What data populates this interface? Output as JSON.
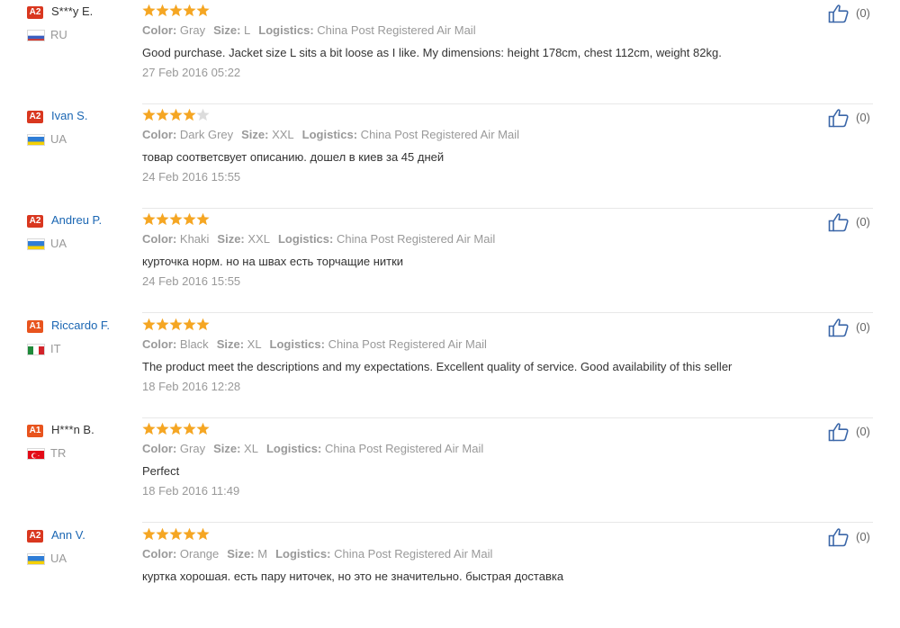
{
  "labels": {
    "color": "Color:",
    "size": "Size:",
    "logistics": "Logistics:"
  },
  "colors": {
    "star_on": "#f5a623",
    "star_off": "#dcdcdc",
    "name": "#333333",
    "link": "#1a66b3",
    "level_a2": "#d9371f",
    "level_a1": "#e8541e",
    "like_icon": "#3a66a8"
  },
  "reviews": [
    {
      "level": "A2",
      "name": "S***y E.",
      "country": "RU",
      "flag": "ru",
      "stars": 5,
      "color": "Gray",
      "size": "L",
      "logistics": "China Post Registered Air Mail",
      "text": "Good purchase. Jacket size L sits a bit loose as I like. My dimensions: height 178cm, chest 112cm, weight 82kg.",
      "date": "27 Feb 2016 05:22",
      "likes": "(0)"
    },
    {
      "level": "A2",
      "name": "Ivan S.",
      "country": "UA",
      "flag": "ua",
      "stars": 4,
      "color": "Dark Grey",
      "size": "XXL",
      "logistics": "China Post Registered Air Mail",
      "text": "товар соответсвует описанию. дошел в киев за 45 дней",
      "date": "24 Feb 2016 15:55",
      "likes": "(0)"
    },
    {
      "level": "A2",
      "name": "Andreu P.",
      "country": "UA",
      "flag": "ua",
      "stars": 5,
      "color": "Khaki",
      "size": "XXL",
      "logistics": "China Post Registered Air Mail",
      "text": "курточка норм. но на швах есть торчащие нитки",
      "date": "24 Feb 2016 15:55",
      "likes": "(0)"
    },
    {
      "level": "A1",
      "name": "Riccardo F.",
      "country": "IT",
      "flag": "it",
      "stars": 5,
      "color": "Black",
      "size": "XL",
      "logistics": "China Post Registered Air Mail",
      "text": "The product meet the descriptions and my expectations. Excellent quality of service. Good availability of this seller",
      "date": "18 Feb 2016 12:28",
      "likes": "(0)"
    },
    {
      "level": "A1",
      "name": "H***n B.",
      "country": "TR",
      "flag": "tr",
      "stars": 5,
      "color": "Gray",
      "size": "XL",
      "logistics": "China Post Registered Air Mail",
      "text": "Perfect",
      "date": "18 Feb 2016 11:49",
      "likes": "(0)"
    },
    {
      "level": "A2",
      "name": "Ann V.",
      "country": "UA",
      "flag": "ua",
      "stars": 5,
      "color": "Orange",
      "size": "M",
      "logistics": "China Post Registered Air Mail",
      "text": "куртка хорошая. есть пару ниточек, но это не значительно. быстрая доставка",
      "date": "",
      "likes": "(0)"
    }
  ]
}
